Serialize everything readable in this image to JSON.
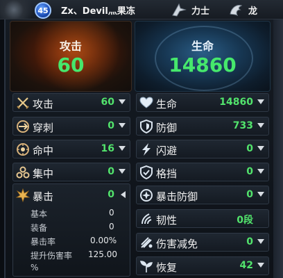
{
  "header": {
    "level": "45",
    "player_name": "Zx、Devil灬果冻",
    "class_label": "力士",
    "race_label": "龙",
    "class_icon": "warrior-class-icon",
    "race_icon": "dragon-race-icon"
  },
  "attack_panel": {
    "title": "攻击",
    "value": "60"
  },
  "life_panel": {
    "title": "生命",
    "value": "14860"
  },
  "left_stats": [
    {
      "label": "攻击",
      "value": "60",
      "icon": "crossed-swords-icon"
    },
    {
      "label": "穿刺",
      "value": "0",
      "icon": "pierce-icon"
    },
    {
      "label": "命中",
      "value": "16",
      "icon": "target-icon"
    },
    {
      "label": "集中",
      "value": "0",
      "icon": "focus-icon"
    },
    {
      "label": "暴击",
      "value": "0",
      "icon": "critical-burst-icon"
    }
  ],
  "crit_details": [
    {
      "label": "基本",
      "value": "0"
    },
    {
      "label": "装备",
      "value": "0"
    },
    {
      "label": "暴击率",
      "value": "0.00%"
    },
    {
      "label": "提升伤害率",
      "value": "125.00",
      "suffix": "%"
    }
  ],
  "right_stats": [
    {
      "label": "生命",
      "value": "14860",
      "icon": "heart-icon"
    },
    {
      "label": "防御",
      "value": "733",
      "icon": "shield-icon"
    },
    {
      "label": "闪避",
      "value": "0",
      "icon": "lightning-dodge-icon"
    },
    {
      "label": "格挡",
      "value": "0",
      "icon": "block-shield-icon"
    },
    {
      "label": "暴击防御",
      "value": "0",
      "icon": "crit-defense-icon"
    },
    {
      "label": "韧性",
      "value": "0段",
      "icon": "toughness-icon"
    },
    {
      "label": "伤害减免",
      "value": "0",
      "icon": "damage-reduction-icon"
    },
    {
      "label": "恢复",
      "value": "42",
      "icon": "recovery-icon"
    }
  ],
  "colors": {
    "value_green": "#52e36c",
    "attack_red": "#7a2a0c",
    "life_blue": "#2a5d86"
  }
}
